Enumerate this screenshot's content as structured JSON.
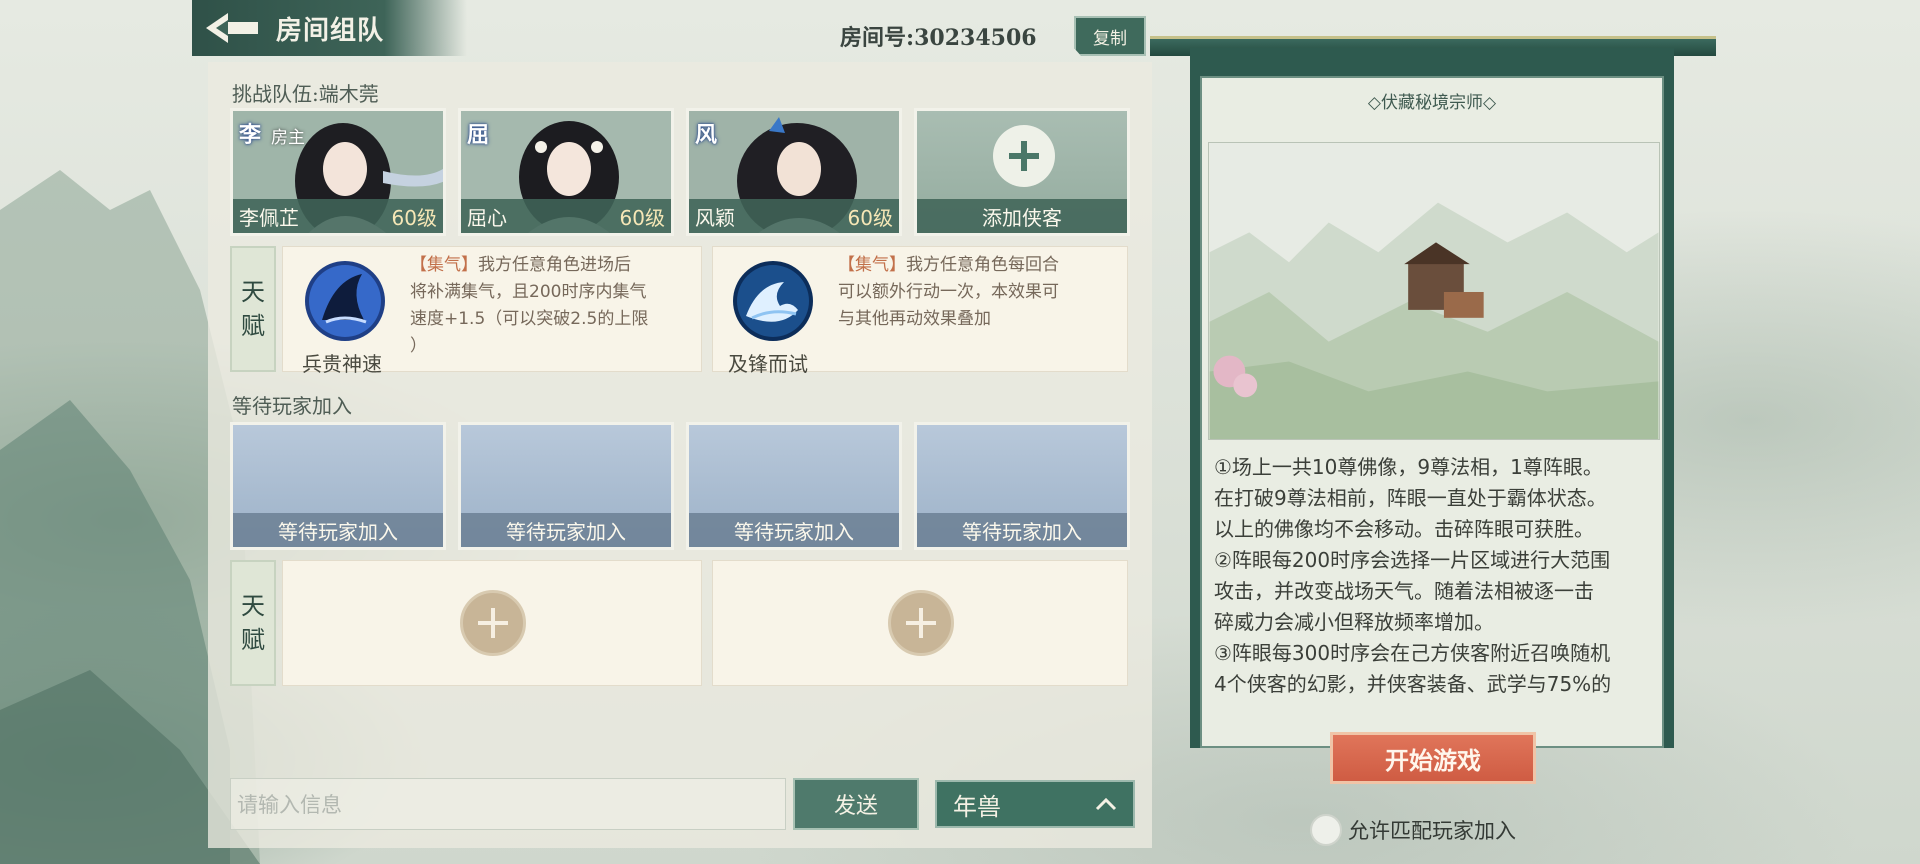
{
  "header": {
    "title": "房间组队",
    "room_number": "房间号:30234506",
    "copy_label": "复制"
  },
  "team": {
    "label": "挑战队伍:端木莞",
    "members": [
      {
        "tag": "李",
        "host": "房主",
        "name": "李佩芷",
        "level": "60级"
      },
      {
        "tag": "屈",
        "name": "屈心",
        "level": "60级"
      },
      {
        "tag": "风",
        "name": "风颖",
        "level": "60级"
      }
    ],
    "add_label": "添加侠客"
  },
  "talent": {
    "tag_top": "天",
    "tag_bottom": "赋",
    "skills": [
      {
        "keyword": "【集气】",
        "desc_1": "我方任意角色进场后",
        "desc_2": "将补满集气，且200时序内集气",
        "desc_3": "速度+1.5（可以突破2.5的上限",
        "desc_4": "）",
        "name": "兵贵神速"
      },
      {
        "keyword": "【集气】",
        "desc_1": "我方任意角色每回合",
        "desc_2": "可以额外行动一次，本效果可",
        "desc_3": "与其他再动效果叠加",
        "name": "及锋而试"
      }
    ]
  },
  "waiting": {
    "label": "等待玩家加入",
    "slots": [
      "等待玩家加入",
      "等待玩家加入",
      "等待玩家加入",
      "等待玩家加入"
    ]
  },
  "chat": {
    "placeholder": "请输入信息",
    "send_label": "发送",
    "select_value": "年兽"
  },
  "info": {
    "title": "◇伏藏秘境宗师◇",
    "lines": [
      "①场上一共10尊佛像，9尊法相，1尊阵眼。",
      "在打破9尊法相前，阵眼一直处于霸体状态。",
      "以上的佛像均不会移动。击碎阵眼可获胜。",
      "②阵眼每200时序会选择一片区域进行大范围",
      "攻击，并改变战场天气。随着法相被逐一击",
      "碎威力会减小但释放频率增加。",
      "③阵眼每300时序会在己方侠客附近召唤随机",
      "4个侠客的幻影，并侠客装备、武学与75%的"
    ],
    "start_label": "开始游戏",
    "allow_label": "允许匹配玩家加入"
  },
  "colors": {
    "accent_green": "#3f7262",
    "start_red": "#d9644b",
    "keyword": "#c2704a"
  }
}
